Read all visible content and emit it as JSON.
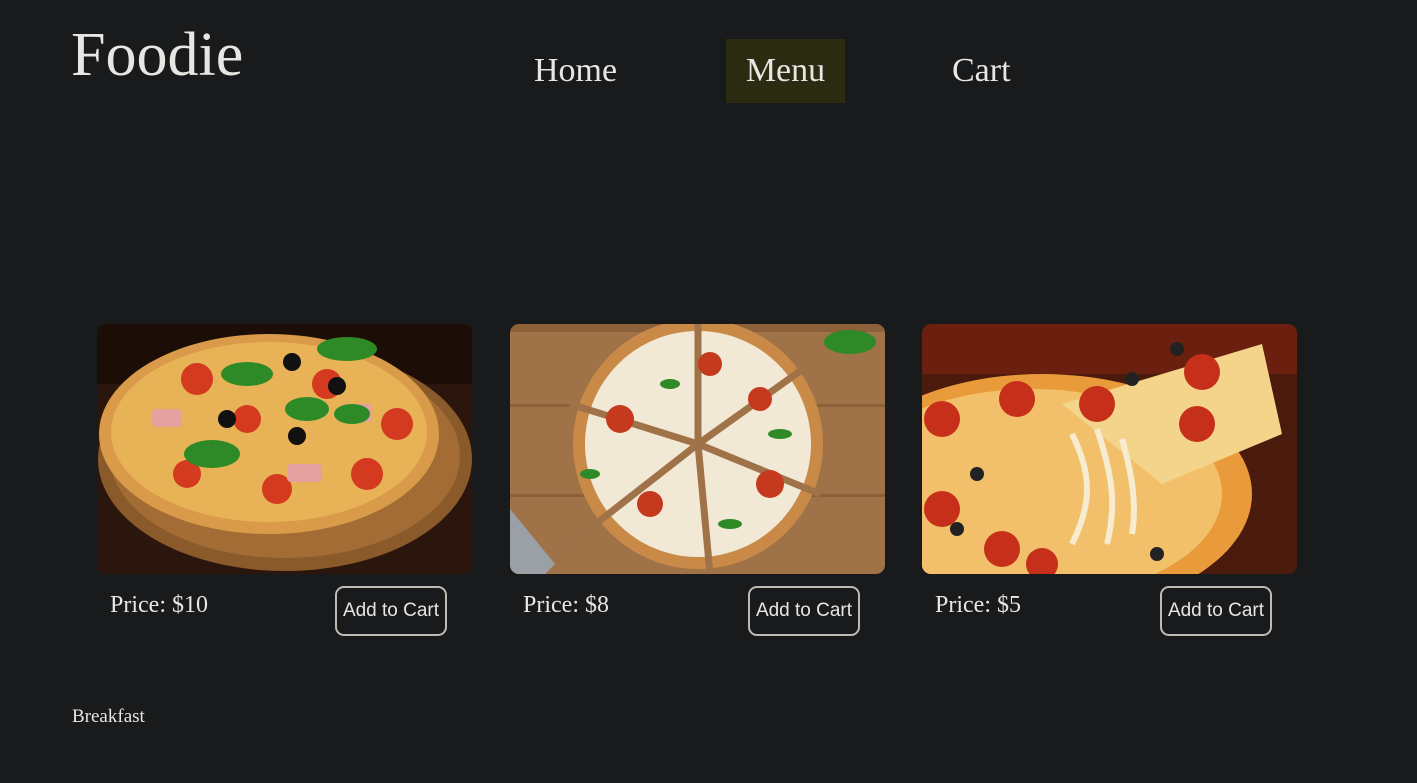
{
  "header": {
    "logo": "Foodie",
    "nav": [
      {
        "label": "Home",
        "active": false
      },
      {
        "label": "Menu",
        "active": true
      },
      {
        "label": "Cart",
        "active": false
      }
    ]
  },
  "products": [
    {
      "image": "pizza-whole-on-board-image",
      "price": "Price: $10",
      "button": "Add to Cart"
    },
    {
      "image": "pizza-sliced-margherita-image",
      "price": "Price: $8",
      "button": "Add to Cart"
    },
    {
      "image": "pizza-pepperoni-cheese-pull-image",
      "price": "Price: $5",
      "button": "Add to Cart"
    }
  ],
  "section": {
    "label": "Breakfast"
  },
  "colors": {
    "background": "#181a1b",
    "text": "#e8e6e3",
    "active_nav_bg": "#2b2b11",
    "button_border": "#bfbab2"
  }
}
